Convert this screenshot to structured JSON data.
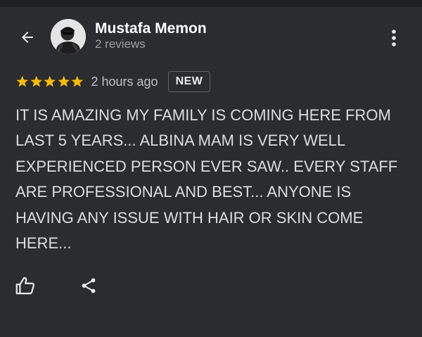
{
  "reviewer": {
    "name": "Mustafa Memon",
    "meta": "2 reviews"
  },
  "review": {
    "rating": 5,
    "max_rating": 5,
    "time_ago": "2 hours ago",
    "badge": "NEW",
    "text": "IT IS AMAZING MY FAMILY IS COMING HERE FROM LAST 5 YEARS... ALBINA MAM IS VERY WELL EXPERIENCED PERSON EVER SAW.. EVERY STAFF ARE PROFESSIONAL AND BEST... ANYONE IS HAVING ANY ISSUE WITH HAIR OR SKIN COME HERE..."
  },
  "icons": {
    "back": "arrow-left-icon",
    "more": "more-vert-icon",
    "like": "thumb-up-icon",
    "share": "share-icon"
  },
  "colors": {
    "background": "#2b2c2f",
    "star": "#fbbc04",
    "name": "#ffffff",
    "meta": "#9aa0a6"
  }
}
